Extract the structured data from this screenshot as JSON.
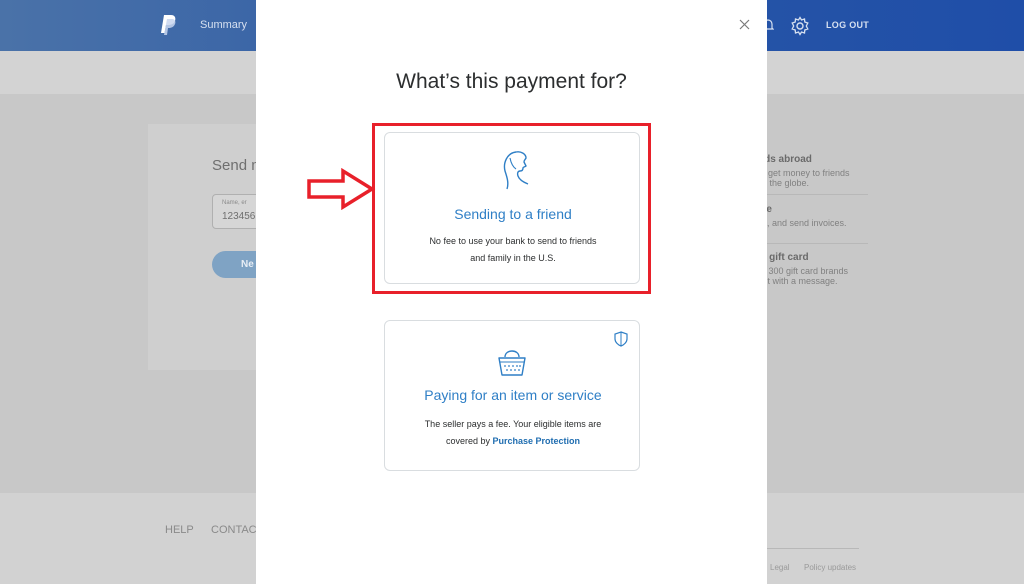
{
  "header": {
    "nav_summary": "Summary",
    "logout": "LOG OUT",
    "icons": [
      "paypal-logo",
      "bell-icon",
      "gear-icon"
    ]
  },
  "background": {
    "send_title": "Send m",
    "name_field_placeholder": "Name, er",
    "name_field_value": "123456",
    "next_label": "Ne",
    "sidebar": [
      {
        "heading": "nds abroad",
        "lines": [
          "to get money to friends",
          "ss the globe."
        ]
      },
      {
        "heading": "ice",
        "lines": [
          "ck, and send invoices."
        ]
      },
      {
        "heading": "al gift card",
        "lines": [
          "er 300 gift card brands",
          "e it with a message."
        ]
      }
    ],
    "footer": {
      "help": "HELP",
      "contact": "CONTAC",
      "legal": "Legal",
      "policy": "Policy updates"
    }
  },
  "modal": {
    "title": "What’s this payment for?",
    "close_icon": "close-icon",
    "options": [
      {
        "icon": "person-silhouette-icon",
        "title": "Sending to a friend",
        "desc_line1": "No fee to use your bank to send to friends",
        "desc_line2": "and family in the U.S."
      },
      {
        "icon": "basket-icon",
        "badge_icon": "shield-icon",
        "title": "Paying for an item or service",
        "desc_line1": "The seller pays a fee. Your eligible items are",
        "desc_line2_prefix": "covered by ",
        "desc_link": "Purchase Protection"
      }
    ]
  },
  "annotation": {
    "highlight_color": "#e8202a",
    "arrow_icon": "right-arrow-icon"
  },
  "colors": {
    "brand_blue": "#2856a6",
    "link_blue": "#2f7fc6",
    "accent_red": "#e8202a"
  }
}
